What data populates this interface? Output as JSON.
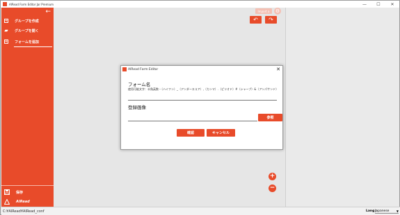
{
  "window": {
    "title": "AIRead Form Editor Jar Premium",
    "controls": {
      "minimize": "—",
      "maximize": "☐",
      "close": "✕"
    }
  },
  "sidebar": {
    "back_icon": "←",
    "items": [
      {
        "label": "グループを作成",
        "icon": "plus-box-icon",
        "icon_char": "+"
      },
      {
        "label": "グループを開く",
        "icon": "folder-open-icon",
        "icon_char": "▰"
      },
      {
        "label": "フォームを追加",
        "icon": "plus-box-icon",
        "icon_char": "+"
      }
    ],
    "save_label": "保存",
    "brand_label": "AIRead"
  },
  "toolbar": {
    "faded_button_label": "Import a",
    "undo_icon": "↶",
    "redo_icon": "↷",
    "gear_icon": "⚙"
  },
  "canvas": {
    "zoom_in_icon": "+",
    "zoom_out_icon": "−"
  },
  "dialog": {
    "title": "AIRead Form Editor",
    "close_icon": "✕",
    "form_name_label": "フォーム名",
    "form_name_hint": "使用可能文字：半角英数・（ハイフン）_（アンダースコア）,（カンマ）.（ピリオド）#（シャープ）&（アンパサンド）",
    "form_name_value": "",
    "image_label": "登録画像",
    "image_value": "",
    "browse_label": "参照",
    "ok_label": "確認",
    "cancel_label": "キャンセル"
  },
  "statusbar": {
    "path": "C:¥AIRead¥AIRead_conf",
    "lang_label": "Lang :",
    "lang_value": "Japanese",
    "lang_arrow": "▼"
  },
  "colors": {
    "accent": "#e84b2a",
    "accent_faded": "#f4c0b4",
    "background": "#e6e6e6"
  }
}
